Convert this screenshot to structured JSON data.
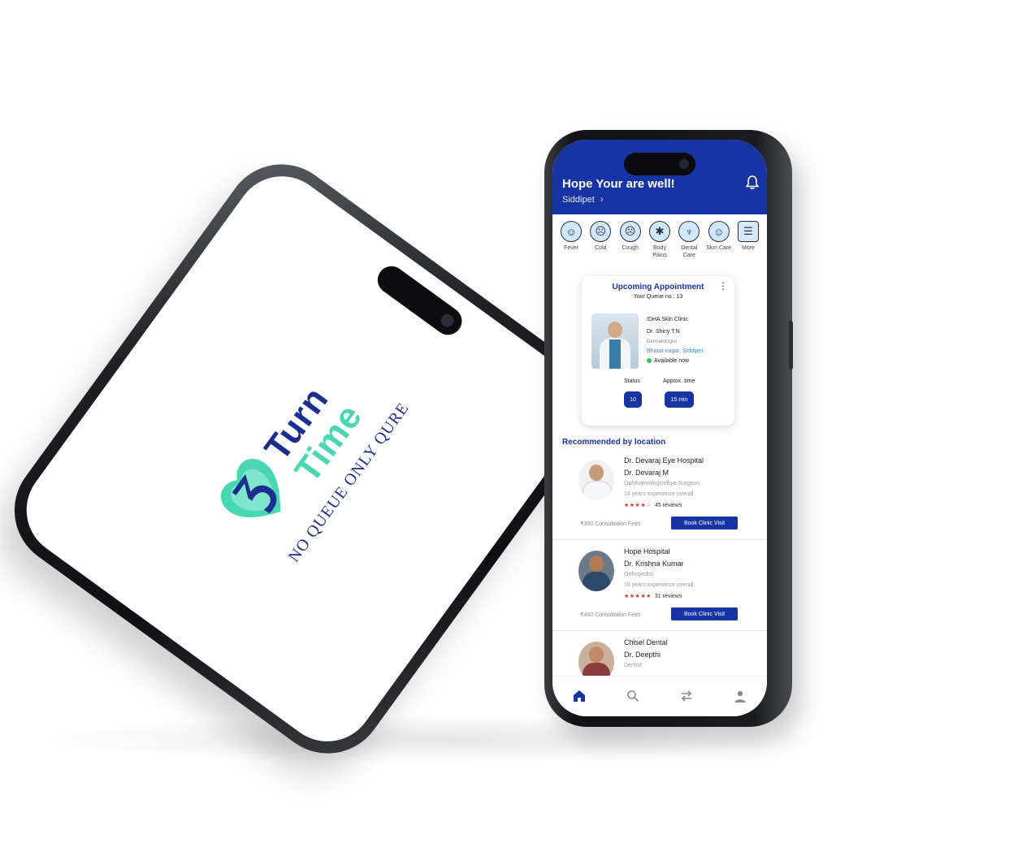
{
  "splash": {
    "brand_turn": "Turn",
    "brand_time": "Time",
    "tagline": "NO QUEUE ONLY QURE"
  },
  "header": {
    "greeting": "Hope Your are well!",
    "location": "Siddipet",
    "location_chevron": "›"
  },
  "categories": [
    {
      "icon": "fever-icon",
      "glyph": "☺",
      "label": "Fever"
    },
    {
      "icon": "cold-icon",
      "glyph": "☹",
      "label": "Cold"
    },
    {
      "icon": "cough-icon",
      "glyph": "☹",
      "label": "Cough"
    },
    {
      "icon": "body-pains-icon",
      "glyph": "✱",
      "label": "Body Pains"
    },
    {
      "icon": "dental-care-icon",
      "glyph": "♆",
      "label": "Dental Care"
    },
    {
      "icon": "skin-care-icon",
      "glyph": "☺",
      "label": "Skin Care"
    },
    {
      "icon": "menu-icon",
      "glyph": "☰",
      "label": "More"
    }
  ],
  "appointment": {
    "title": "Upcoming Appointment",
    "queue": "Your Queue no : 13",
    "clinic": "IDHA Skin Clinic",
    "doctor": "Dr. Shiny T.N",
    "specialty": "Dermatologist",
    "address": "Bharat nagar, Siddipet",
    "availability": "Available now",
    "status_label": "Status",
    "status_value": "10",
    "time_label": "Approx. time",
    "time_value": "15 min"
  },
  "recommended": {
    "title": "Recommended by location",
    "doctors": [
      {
        "hospital": "Dr. Devaraj Eye Hospital",
        "name": "Dr. Devaraj M",
        "specialty": "Ophthalmologist/Eye Surgeon",
        "experience": "14 years experience overall",
        "stars": "★★★★☆",
        "rating": 4,
        "reviews": "45 reviews",
        "fee": "₹300 Consultation Fees",
        "book_label": "Book Clinic Visit"
      },
      {
        "hospital": "Hope Hospital",
        "name": "Dr. Krishna Kumar",
        "specialty": "Orthopedist",
        "experience": "18 years experience overall",
        "stars": "★★★★★",
        "rating": 5,
        "reviews": "31 reviews",
        "fee": "₹400 Consultation Fees",
        "book_label": "Book Clinic Visit"
      },
      {
        "hospital": "Chisel Dental",
        "name": "Dr. Deepthi",
        "specialty": "Dentist"
      }
    ]
  },
  "nav": [
    {
      "icon": "home-icon",
      "active": true
    },
    {
      "icon": "search-icon",
      "active": false
    },
    {
      "icon": "transfer-icon",
      "active": false
    },
    {
      "icon": "profile-icon",
      "active": false
    }
  ],
  "colors": {
    "primary": "#1734a4",
    "brand_dark": "#1a2f8f",
    "brand_accent": "#49d6b2",
    "star": "#e0312d",
    "available": "#35c36a"
  }
}
